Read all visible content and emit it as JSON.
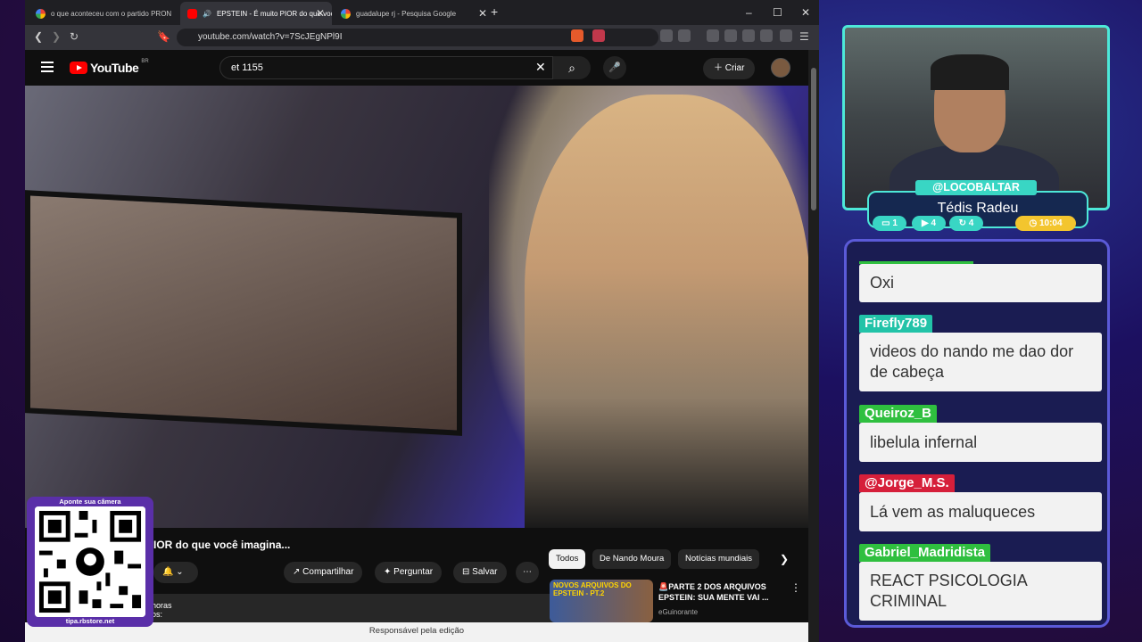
{
  "browser": {
    "tabs": [
      {
        "label": "o que aconteceu com o partido PRONA - Pe"
      },
      {
        "label": "EPSTEIN - É muito PIOR do que voc"
      },
      {
        "label": "guadalupe rj - Pesquisa Google"
      }
    ],
    "url": "youtube.com/watch?v=7ScJEgNPl9I"
  },
  "youtube": {
    "logo": "YouTube",
    "region": "BR",
    "search_value": "et 1155",
    "create_label": "Criar",
    "video_title": "IOR do que você imagina...",
    "share_label": "Compartilhar",
    "ask_label": "Perguntar",
    "save_label": "Salvar",
    "desc_line1": "horas",
    "desc_line2": "os:",
    "chips": [
      "Todos",
      "De Nando Moura",
      "Notícias mundiais"
    ],
    "rec": {
      "thumb_text": "NOVOS ARQUIVOS DO EPSTEIN - PT.2",
      "title": "🚨PARTE 2 DOS ARQUIVOS EPSTEIN: SUA MENTE VAI ...",
      "channel": "eGuinorante"
    },
    "footer": "Responsável pela edição"
  },
  "qr": {
    "top": "Aponte sua câmera",
    "bottom": "tipa.rbstore.net"
  },
  "stream": {
    "handle": "@LOCOBALTAR",
    "name": "Tédis Radeu",
    "badges": [
      {
        "icon": "chat-icon",
        "value": "1",
        "color": "#39d6c4"
      },
      {
        "icon": "video-icon",
        "value": "4",
        "color": "#39d6c4"
      },
      {
        "icon": "refresh-icon",
        "value": "4",
        "color": "#39d6c4"
      },
      {
        "icon": "clock-icon",
        "value": "10:04",
        "color": "#f3c52e"
      }
    ]
  },
  "chat": [
    {
      "user": "",
      "message": "Oxi",
      "color": "#2fbf3f"
    },
    {
      "user": "Firefly789",
      "message": "videos do nando me dao dor de cabeça",
      "color": "#22c3a8"
    },
    {
      "user": "Queiroz_B",
      "message": "libelula infernal",
      "color": "#2fbf3f"
    },
    {
      "user": "@Jorge_M.S.",
      "message": "Lá vem as maluqueces",
      "color": "#d61f3a"
    },
    {
      "user": "Gabriel_Madridista",
      "message": "REACT PSICOLOGIA CRIMINAL",
      "color": "#2fbf3f"
    }
  ]
}
